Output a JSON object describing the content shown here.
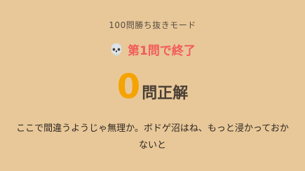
{
  "result": {
    "mode_title": "100問勝ち抜きモード",
    "end_icon": "skull-icon",
    "end_icon_glyph": "💀",
    "end_text": "第1問で終了",
    "score_value": "0",
    "score_unit": "問正解",
    "message": "ここで間違うようじゃ無理か。ボドゲ沼はね、もっと浸かっておかないと"
  },
  "colors": {
    "background": "#e8c899",
    "end_text": "#f25c5c",
    "score_value": "#f5a300"
  }
}
